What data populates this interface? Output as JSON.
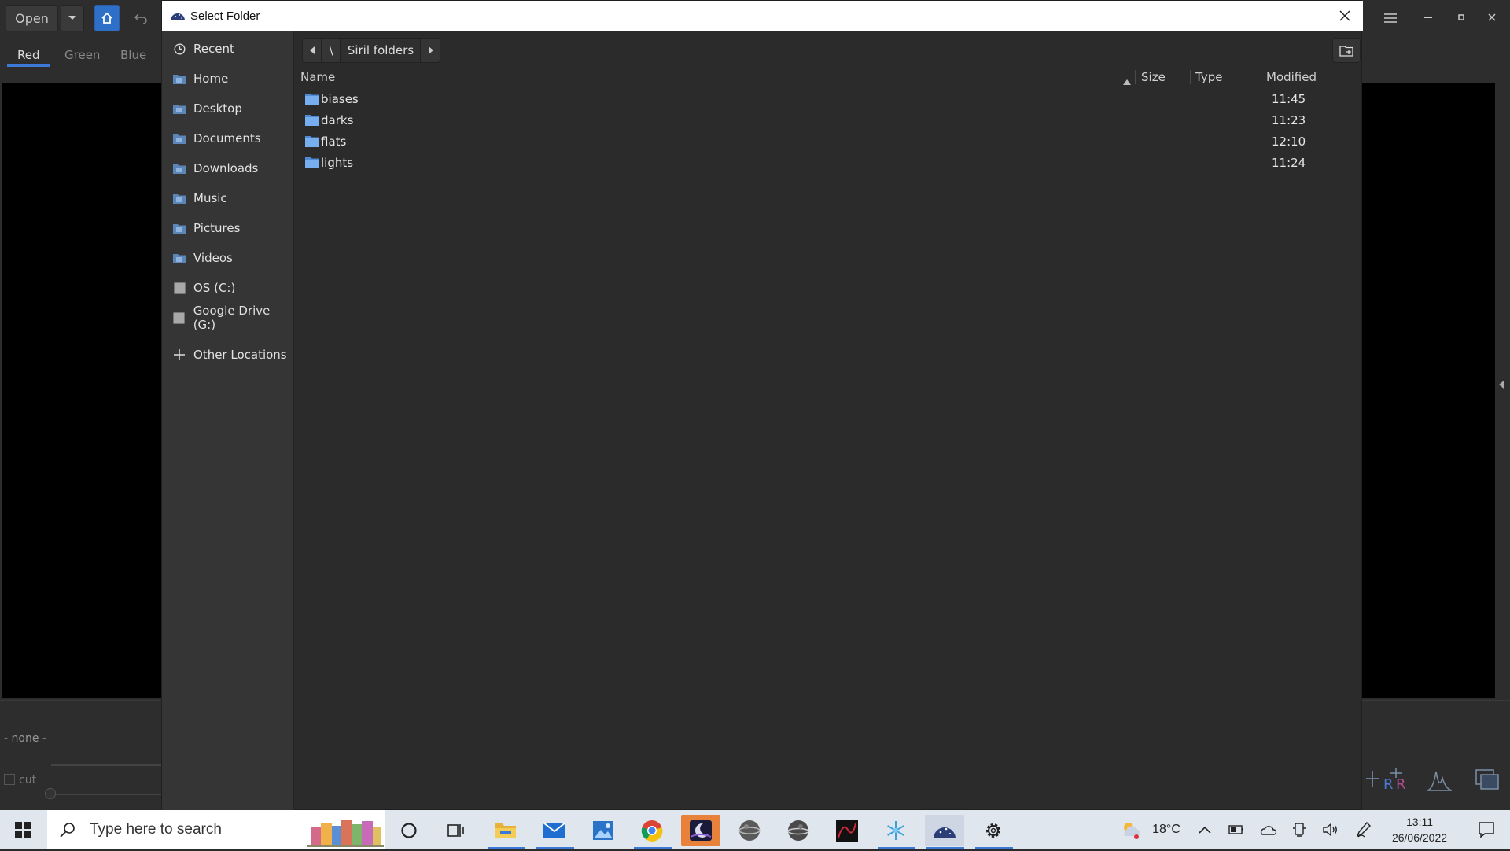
{
  "app": {
    "toolbar": {
      "open_label": "Open"
    },
    "channel_tabs": [
      "Red",
      "Green",
      "Blue"
    ],
    "status_text": "- none -",
    "cut_label": "cut"
  },
  "dialog": {
    "title": "Select Folder",
    "sidebar": {
      "items": [
        {
          "label": "Recent",
          "icon": "clock-icon"
        },
        {
          "label": "Home",
          "icon": "folder-icon"
        },
        {
          "label": "Desktop",
          "icon": "folder-icon"
        },
        {
          "label": "Documents",
          "icon": "folder-icon"
        },
        {
          "label": "Downloads",
          "icon": "folder-icon"
        },
        {
          "label": "Music",
          "icon": "folder-icon"
        },
        {
          "label": "Pictures",
          "icon": "folder-icon"
        },
        {
          "label": "Videos",
          "icon": "folder-icon"
        },
        {
          "label": "OS (C:)",
          "icon": "drive-icon"
        },
        {
          "label": "Google Drive (G:)",
          "icon": "drive-icon"
        }
      ],
      "other_locations": "Other Locations"
    },
    "path": {
      "root": "\\",
      "current": "Siril folders"
    },
    "columns": {
      "name": "Name",
      "size": "Size",
      "type": "Type",
      "modified": "Modified"
    },
    "files": [
      {
        "name": "biases",
        "modified": "11:45"
      },
      {
        "name": "darks",
        "modified": "11:23"
      },
      {
        "name": "flats",
        "modified": "12:10"
      },
      {
        "name": "lights",
        "modified": "11:24"
      }
    ]
  },
  "taskbar": {
    "search_placeholder": "Type here to search",
    "weather": "18°C",
    "time": "13:11",
    "date": "26/06/2022"
  },
  "colors": {
    "accent": "#3b78d8",
    "folder": "#6aa6e8",
    "dialog_bg": "#2b2b2b",
    "sidebar_bg": "#353535"
  }
}
